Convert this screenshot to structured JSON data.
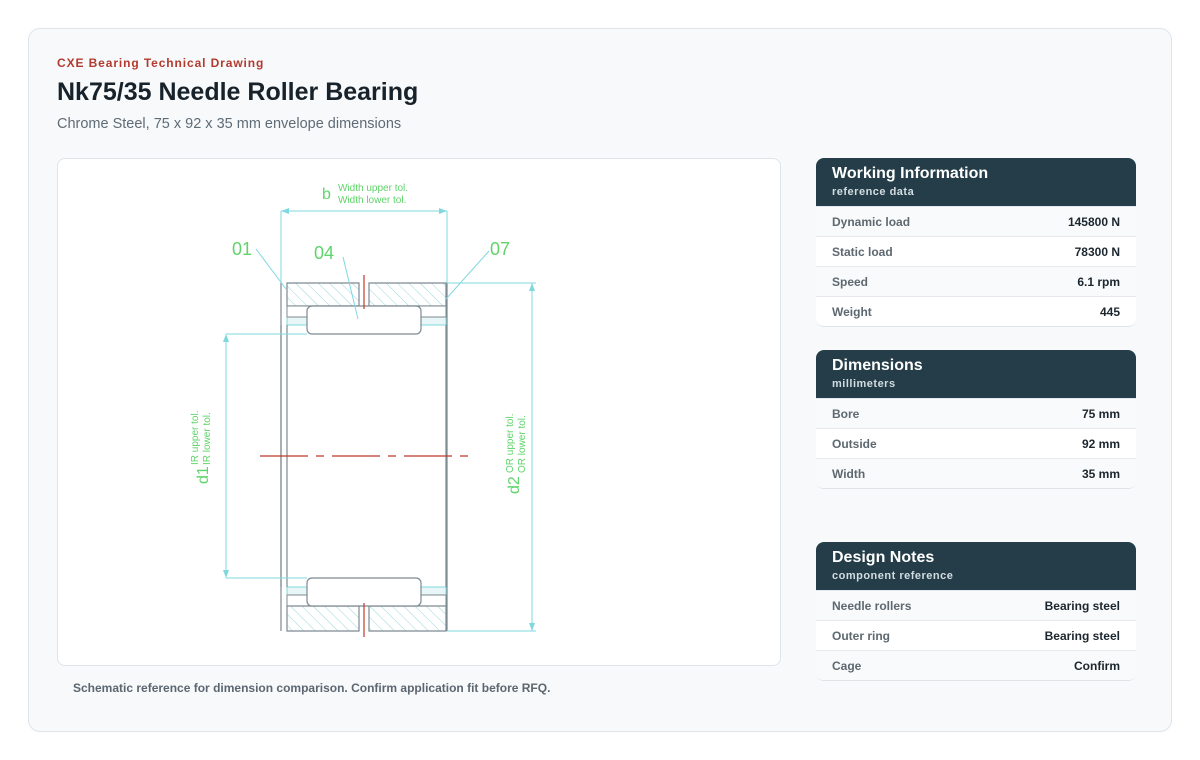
{
  "header": {
    "eyebrow": "CXE Bearing Technical Drawing",
    "title": "Nk75/35 Needle Roller Bearing",
    "subtitle": "Chrome Steel, 75 x 92 x 35 mm envelope dimensions"
  },
  "drawing": {
    "width_symbol": "b",
    "width_upper_tol": "Width upper tol.",
    "width_lower_tol": "Width lower tol.",
    "part_01": "01",
    "part_04": "04",
    "part_07": "07",
    "d1_symbol": "d1",
    "ir_upper_tol": "IR upper tol.",
    "ir_lower_tol": "IR lower tol.",
    "d2_symbol": "d2",
    "or_upper_tol": "OR upper tol.",
    "or_lower_tol": "OR lower tol.",
    "colors": {
      "dimension": "#5fd46a",
      "leader": "#7fd8de",
      "centerline": "#c0392b",
      "outline": "#7d8a92",
      "hatch": "#9bd6d9"
    }
  },
  "caption": "Schematic reference for dimension comparison. Confirm application fit before RFQ.",
  "working": {
    "title": "Working Information",
    "subtitle": "reference data",
    "rows": [
      {
        "label": "Dynamic load",
        "value": "145800 N"
      },
      {
        "label": "Static load",
        "value": "78300 N"
      },
      {
        "label": "Speed",
        "value": "6.1 rpm"
      },
      {
        "label": "Weight",
        "value": "445"
      }
    ]
  },
  "dimensions": {
    "title": "Dimensions",
    "subtitle": "millimeters",
    "rows": [
      {
        "label": "Bore",
        "value": "75 mm"
      },
      {
        "label": "Outside",
        "value": "92 mm"
      },
      {
        "label": "Width",
        "value": "35 mm"
      }
    ]
  },
  "notes": {
    "title": "Design Notes",
    "subtitle": "component reference",
    "rows": [
      {
        "label": "Needle rollers",
        "value": "Bearing steel"
      },
      {
        "label": "Outer ring",
        "value": "Bearing steel"
      },
      {
        "label": "Cage",
        "value": "Confirm"
      }
    ]
  }
}
